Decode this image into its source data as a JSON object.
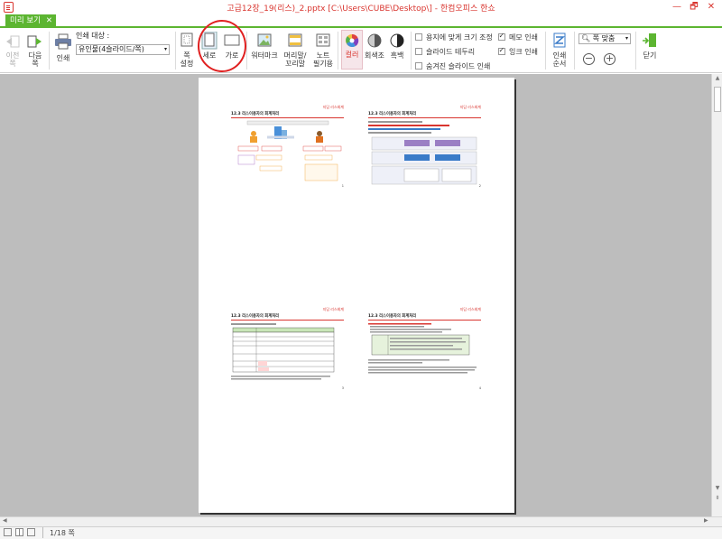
{
  "window": {
    "title": "고급12장_19(리스)_2.pptx [C:\\Users\\CUBE\\Desktop\\] - 한컴오피스 한쇼",
    "minimize": "—",
    "restore": "🗗",
    "close": "✕"
  },
  "tabs": [
    {
      "label": "미리 보기",
      "close": "✕"
    }
  ],
  "ribbon": {
    "prev_label": "이전\n쪽",
    "next_label": "다음\n쪽",
    "print_label": "인쇄",
    "print_target_label": "인쇄 대상 :",
    "print_target_value": "유인물(4슬라이드/쪽)",
    "page_setup_label": "쪽\n설정",
    "portrait_label": "세로",
    "landscape_label": "가로",
    "watermark_label": "워터마크",
    "header_footer_label": "머리말/\n꼬리말",
    "notes_label": "노트\n필기용",
    "color_label": "컬러",
    "grayscale_label": "회색조",
    "bw_label": "흑백",
    "checkboxes": [
      {
        "label": "용지에 맞게 크기 조정",
        "checked": false
      },
      {
        "label": "메모 인쇄",
        "checked": true
      },
      {
        "label": "슬라이드 테두리",
        "checked": false
      },
      {
        "label": "잉크 인쇄",
        "checked": true
      },
      {
        "label": "숨겨진 슬라이드 인쇄",
        "checked": false
      }
    ],
    "print_order_label": "인쇄\n순서",
    "zoom_value": "쪽 맞춤",
    "close_label": "닫기",
    "accent_color": "#5cb531",
    "brand_color": "#d9352f"
  },
  "slides": [
    {
      "head": "지담 리스회계",
      "title": "12.3 리스이용자의 회계처리",
      "page": "1"
    },
    {
      "head": "지담 리스회계",
      "title": "12.3 리스이용자의 회계처리",
      "page": "2"
    },
    {
      "head": "지담 리스회계",
      "title": "12.3 리스이용자의 회계처리",
      "page": "3"
    },
    {
      "head": "지담 리스회계",
      "title": "12.3 리스이용자의 회계처리",
      "page": "4"
    }
  ],
  "status": {
    "page_info": "1/18 쪽"
  }
}
